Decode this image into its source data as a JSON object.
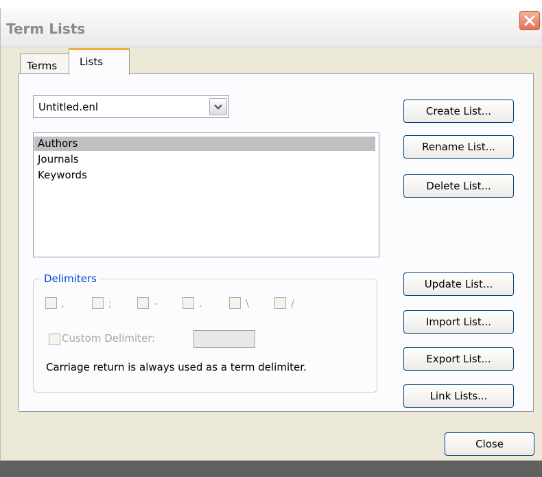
{
  "window": {
    "title": "Term Lists"
  },
  "tabs": [
    {
      "label": "Terms"
    },
    {
      "label": "Lists"
    }
  ],
  "library_select": {
    "value": "Untitled.enl"
  },
  "term_lists": [
    {
      "label": "Authors",
      "selected": true
    },
    {
      "label": "Journals"
    },
    {
      "label": "Keywords"
    }
  ],
  "buttons": {
    "create": "Create List...",
    "rename": "Rename List...",
    "delete": "Delete List...",
    "update": "Update List...",
    "import": "Import List...",
    "export": "Export List...",
    "link": "Link Lists...",
    "close": "Close"
  },
  "delimiters": {
    "legend": "Delimiters",
    "options": [
      {
        "symbol": ","
      },
      {
        "symbol": ";"
      },
      {
        "symbol": "-"
      },
      {
        "symbol": "."
      },
      {
        "symbol": "\\"
      },
      {
        "symbol": "/"
      }
    ],
    "custom_label": "Custom Delimiter:",
    "custom_value": "",
    "note": "Carriage return is always used as a term delimiter."
  },
  "colors": {
    "dialog_bg": "#ece9d8",
    "panel_bg": "#fcfcfe",
    "selection": "#c0c0c0",
    "legend": "#0046d5",
    "button_border": "#003c74",
    "active_tab_accent": "#f0b03a",
    "close_button": "#e2715a"
  },
  "icons": {
    "close": "close-x-icon",
    "dropdown": "chevron-down-icon"
  }
}
